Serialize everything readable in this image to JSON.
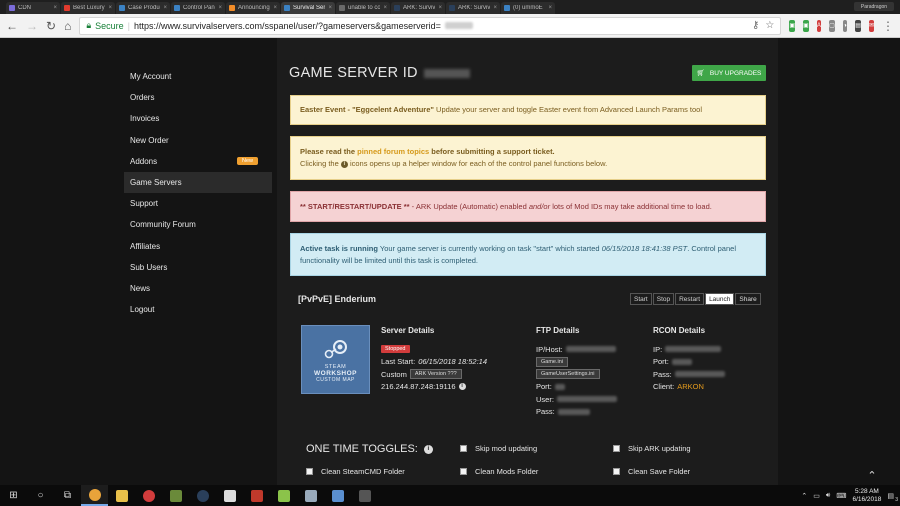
{
  "browser": {
    "tabs": [
      {
        "label": "CDN",
        "icon": "grid-icon",
        "color": "#7b6cd9"
      },
      {
        "label": "Best Luxury",
        "icon": "youtube-icon",
        "color": "#e23b2e"
      },
      {
        "label": "Case Produc",
        "icon": "page-icon",
        "color": "#3b82c4"
      },
      {
        "label": "Control Pane",
        "icon": "page-icon",
        "color": "#3b82c4"
      },
      {
        "label": "Announcing",
        "icon": "page-icon",
        "color": "#f28c28"
      },
      {
        "label": "Survival Serv",
        "icon": "page-icon",
        "color": "#3b82c4"
      },
      {
        "label": "unable to co",
        "icon": "page-icon",
        "color": "#6a6a6a"
      },
      {
        "label": "ARK: Survival",
        "icon": "steam-icon",
        "color": "#2a3f5a"
      },
      {
        "label": "ARK: Survival",
        "icon": "steam-icon",
        "color": "#2a3f5a"
      },
      {
        "label": "(0) ummoE",
        "icon": "page-icon",
        "color": "#3b82c4"
      }
    ],
    "profile_label": "Paradragon",
    "secure_label": "Secure",
    "url": "https://www.survivalservers.com/sspanel/user/?gameservers&gameserverid="
  },
  "sidebar": {
    "items": [
      {
        "label": "My Account"
      },
      {
        "label": "Orders"
      },
      {
        "label": "Invoices"
      },
      {
        "label": "New Order"
      },
      {
        "label": "Addons",
        "badge": "New"
      },
      {
        "label": "Game Servers",
        "active": true
      },
      {
        "label": "Support"
      },
      {
        "label": "Community Forum"
      },
      {
        "label": "Affiliates"
      },
      {
        "label": "Sub Users"
      },
      {
        "label": "News"
      },
      {
        "label": "Logout"
      }
    ]
  },
  "header": {
    "title": "GAME SERVER ID",
    "buy_label": "BUY UPGRADES"
  },
  "alerts": {
    "easter": {
      "strong": "Easter Event - \"Eggcelent Adventure\"",
      "text": " Update your server and toggle Easter event from Advanced Launch Params tool"
    },
    "forum": {
      "pre": "Please read the ",
      "link": "pinned forum topics",
      "post": " before submitting a support ticket.",
      "line2_pre": "Clicking the ",
      "line2_post": " icons opens up a helper window for each of the control panel functions below."
    },
    "ark": {
      "strong": "** START/RESTART/UPDATE **",
      "text": " - ARK Update (Automatic) enabled ",
      "em": "and/or",
      "text2": " lots of Mod IDs may take additional time to load."
    },
    "task": {
      "strong": "Active task is running",
      "text": " Your game server is currently working on task \"start\" which started ",
      "em": "06/15/2018 18:41:38 PST",
      "text2": ". Control panel functionality will be limited until this task is completed."
    }
  },
  "server": {
    "name": "[PvPvE] Enderium",
    "controls": [
      {
        "label": "Start"
      },
      {
        "label": "Stop"
      },
      {
        "label": "Restart"
      },
      {
        "label": "Launch",
        "highlight": true
      },
      {
        "label": "Share",
        "highlight": false
      }
    ],
    "workshop": {
      "line1": "STEAM",
      "line2": "WORKSHOP",
      "line3": "CUSTOM MAP"
    },
    "details": {
      "heading": "Server Details",
      "status": "Stopped",
      "last_start_label": "Last Start:",
      "last_start_value": "06/15/2018 18:52:14",
      "custom_label": "Custom",
      "custom_btn": "ARK Version ???",
      "address": "216.244.87.248:19116"
    },
    "ftp": {
      "heading": "FTP Details",
      "host_label": "IP/Host:",
      "game_ini": "Game.ini",
      "gus_ini": "GameUserSettings.ini",
      "port_label": "Port:",
      "user_label": "User:",
      "pass_label": "Pass:"
    },
    "rcon": {
      "heading": "RCON Details",
      "ip_label": "IP:",
      "port_label": "Port:",
      "pass_label": "Pass:",
      "client_label": "Client:",
      "client_value": "ARKON"
    }
  },
  "toggles": {
    "heading": "ONE TIME TOGGLES:",
    "items": [
      {
        "label": "Skip mod updating"
      },
      {
        "label": "Skip ARK updating"
      },
      {
        "label": "Clean SteamCMD Folder"
      },
      {
        "label": "Clean Mods Folder"
      },
      {
        "label": "Clean Save Folder"
      }
    ]
  },
  "taskbar": {
    "time": "5:28 AM",
    "date": "6/16/2018",
    "notif_count": "3"
  }
}
